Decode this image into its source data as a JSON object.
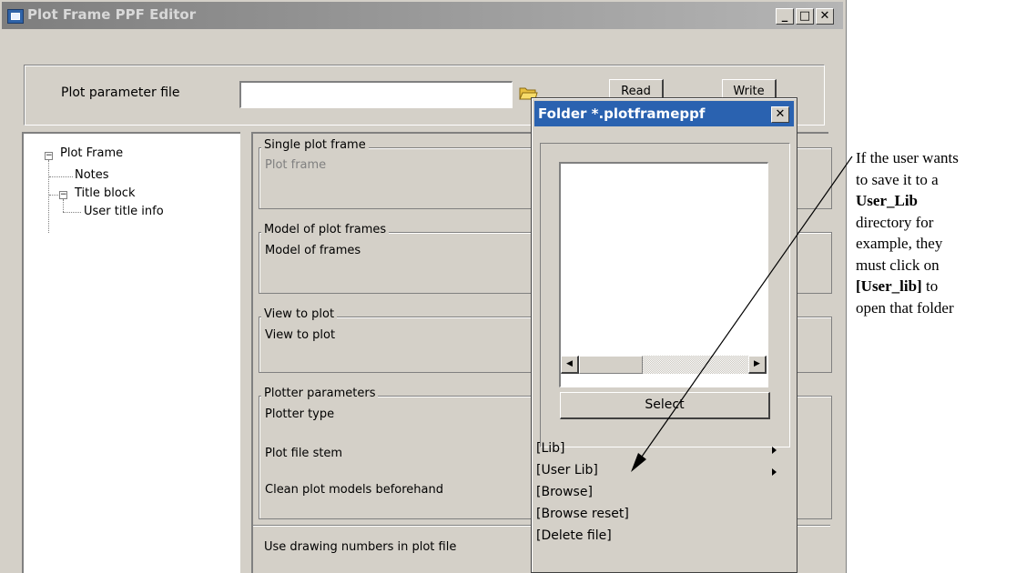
{
  "window": {
    "title": "Plot Frame PPF Editor",
    "caption_minimize": "_",
    "caption_maximize": "□",
    "caption_close": "✕"
  },
  "parameter_file": {
    "label": "Plot parameter file",
    "value": "",
    "read_label": "Read",
    "write_label": "Write"
  },
  "tree": {
    "items": [
      {
        "label": "Plot Frame",
        "expander": "−"
      },
      {
        "label": "Notes"
      },
      {
        "label": "Title block",
        "expander": "−"
      },
      {
        "label": "User title info"
      }
    ]
  },
  "panel": {
    "single_plot_frame": {
      "title": "Single plot frame",
      "field": "Plot frame"
    },
    "model_of_plot_frames": {
      "title": "Model of plot frames",
      "field": "Model of frames"
    },
    "view_to_plot": {
      "title": "View to plot",
      "field": "View to plot"
    },
    "plotter_parameters": {
      "title": "Plotter parameters",
      "plotter_type": "Plotter type",
      "plot_file_stem": "Plot file stem",
      "clean_plot_models": "Clean plot models beforehand"
    },
    "use_drawing_numbers": "Use drawing numbers in plot file"
  },
  "popup": {
    "title": "Folder *.plotframeppf",
    "close": "✕",
    "select_label": "Select",
    "scroll_left": "◀",
    "scroll_right": "▶",
    "menu": [
      {
        "label": "[Lib]",
        "submenu": true
      },
      {
        "label": "[User Lib]",
        "submenu": true
      },
      {
        "label": "[Browse]",
        "submenu": false
      },
      {
        "label": "[Browse reset]",
        "submenu": false
      },
      {
        "label": "[Delete file]",
        "submenu": false
      }
    ]
  },
  "annotation": {
    "lines": [
      "If the user wants",
      "to save it to a",
      "User_Lib",
      "directory for",
      "example, they",
      "must click on",
      "[User_lib] to",
      "open that folder"
    ],
    "bold_lines": [
      2,
      6
    ]
  }
}
